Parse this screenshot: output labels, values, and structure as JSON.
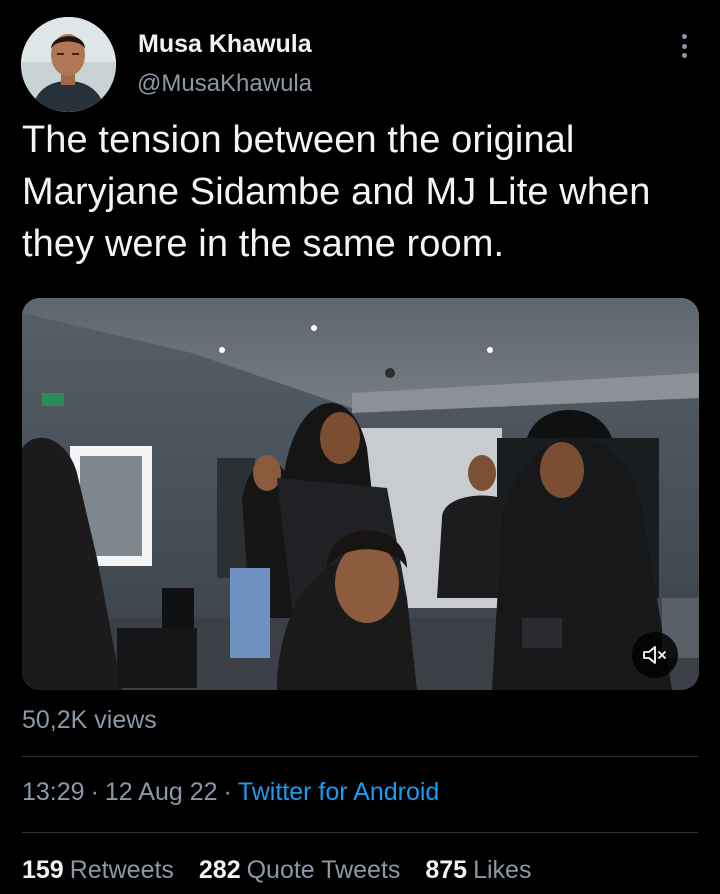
{
  "author": {
    "display_name": "Musa Khawula",
    "handle": "@MusaKhawula",
    "avatar_icon": "profile-photo"
  },
  "tweet": {
    "text": "The tension between the original Maryjane Sidambe and MJ Lite when they were in the same room."
  },
  "media": {
    "type": "video",
    "mute_icon": "speaker-muted-icon",
    "views": "50,2K views"
  },
  "meta": {
    "time": "13:29",
    "date": "12 Aug 22",
    "separator": "·",
    "source": "Twitter for Android"
  },
  "stats": {
    "retweets": {
      "count": "159",
      "label": "Retweets"
    },
    "quotes": {
      "count": "282",
      "label": "Quote Tweets"
    },
    "likes": {
      "count": "875",
      "label": "Likes"
    }
  },
  "colors": {
    "background": "#000000",
    "link": "#1d9bf0",
    "secondary_text": "#8b98a5",
    "primary_text": "#e7e9ea",
    "divider": "#2f3336"
  }
}
